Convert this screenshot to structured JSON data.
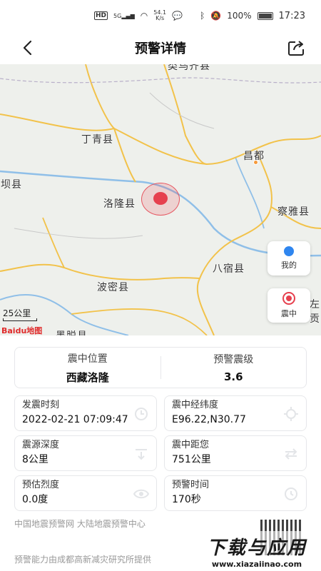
{
  "status_bar": {
    "network_speed": "54.1",
    "speed_unit": "K/s",
    "battery": "100%",
    "time": "17:23",
    "hd": "HD",
    "signal": "5G"
  },
  "header": {
    "title": "预警详情",
    "back_icon": "chevron-left-icon",
    "share_icon": "share-icon"
  },
  "map": {
    "places": [
      "丁青县",
      "昌都",
      "边坝县",
      "洛隆县",
      "察雅县",
      "八宿县",
      "波密县",
      "墨脱县",
      "类乌齐县",
      "左贡"
    ],
    "scale_label": "25公里",
    "logo": "Baidu地图",
    "my_location_label": "我的",
    "epicenter_label": "震中",
    "colors": {
      "road": "#f2c24a",
      "river": "#8fbfe8",
      "quake": "#e6404e",
      "locate": "#2f86ef"
    }
  },
  "summary": {
    "location_label": "震中位置",
    "location_value": "西藏洛隆",
    "magnitude_label": "预警震级",
    "magnitude_value": "3.6"
  },
  "details": {
    "time_label": "发震时刻",
    "time_value": "2022-02-21 07:09:47",
    "coords_label": "震中经纬度",
    "coords_value": "E96.22,N30.77",
    "depth_label": "震源深度",
    "depth_value": "8公里",
    "distance_label": "震中距您",
    "distance_value": "751公里",
    "intensity_label": "预估烈度",
    "intensity_value": "0.0度",
    "warning_time_label": "预警时间",
    "warning_time_value": "170秒"
  },
  "footer": {
    "source": "中国地震预警网 大陆地震预警中心",
    "provider": "预警能力由成都高新减灾研究所提供"
  },
  "watermark": {
    "main": "下载与应用",
    "sub": "www.xiazaiinao.com"
  }
}
